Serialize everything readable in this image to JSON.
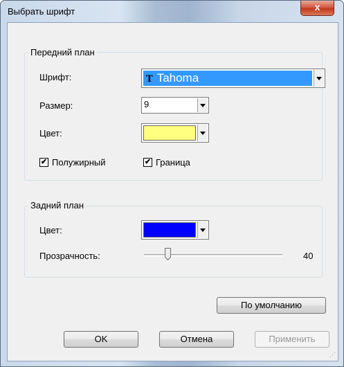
{
  "dialog": {
    "title": "Выбрать шрифт",
    "close_glyph": "x"
  },
  "foreground": {
    "legend": "Передний план",
    "font_label": "Шрифт:",
    "font_value": "Tahoma",
    "font_icon": "T",
    "size_label": "Размер:",
    "size_value": "9",
    "color_label": "Цвет:",
    "color_value": "#ffff80",
    "bold_label": "Полужирный",
    "bold_checked": true,
    "border_label": "Граница",
    "border_checked": true,
    "check_glyph": "✔"
  },
  "background": {
    "legend": "Задний план",
    "color_label": "Цвет:",
    "color_value": "#0000ff",
    "transparency_label": "Прозрачность:",
    "transparency_value": "40"
  },
  "buttons": {
    "default": "По умолчанию",
    "ok": "OK",
    "cancel": "Отмена",
    "apply": "Применить"
  }
}
